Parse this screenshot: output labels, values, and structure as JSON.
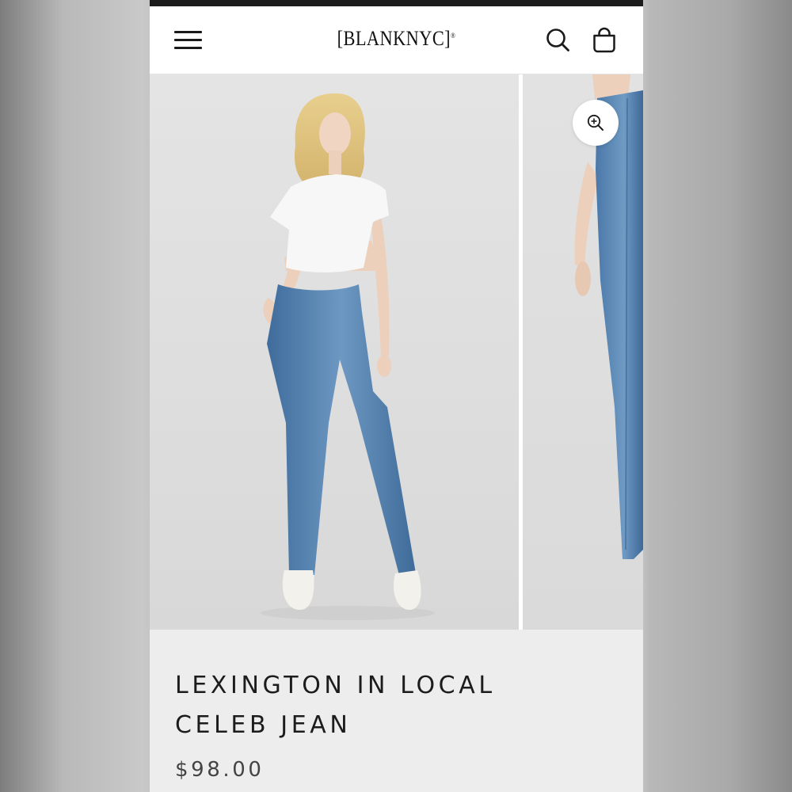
{
  "header": {
    "logo_text": "[BLANKNYC]",
    "logo_mark": "®",
    "menu_icon": "hamburger-menu-icon",
    "search_icon": "search-icon",
    "cart_icon": "shopping-bag-icon"
  },
  "gallery": {
    "slides": [
      {
        "description_icon": "model-front-view-photo"
      },
      {
        "description_icon": "model-side-view-photo"
      }
    ],
    "zoom_icon": "zoom-in-icon"
  },
  "product": {
    "title_line1": "LEXINGTON IN LOCAL",
    "title_line2": "CELEB JEAN",
    "price": "$98.00"
  },
  "colors": {
    "denim": "#4f7fae",
    "header_bg": "#ffffff",
    "info_bg": "#ededed",
    "text": "#1c1c1c"
  }
}
